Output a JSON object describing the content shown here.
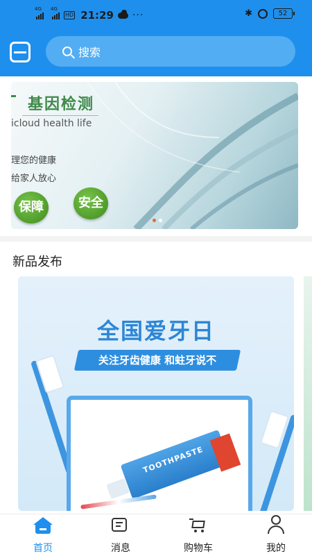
{
  "status_bar": {
    "network_1": "4G",
    "network_2": "4G",
    "hd": "HD",
    "time": "21:29",
    "more": "···",
    "bluetooth": "✱",
    "battery": "52"
  },
  "header": {
    "search_placeholder": "搜索",
    "scan_icon": "scan-icon",
    "search_icon": "search-icon",
    "background_color": "#1e8fec"
  },
  "banner": {
    "title": "基因检测",
    "subtitle": "icloud health life",
    "line1": "理您的健康",
    "line2": "给家人放心",
    "badge_1": "保障",
    "badge_2": "安全",
    "active_page": 1,
    "pages": 2
  },
  "new_products": {
    "section_title": "新品发布",
    "card": {
      "title": "全国爱牙日",
      "ribbon_text": "关注牙齿健康 和蛀牙说不",
      "product_text": "TOOTHPASTE"
    }
  },
  "bottom_nav": {
    "items": [
      {
        "label": "首页",
        "icon": "home-icon",
        "active": true
      },
      {
        "label": "消息",
        "icon": "message-icon",
        "active": false
      },
      {
        "label": "购物车",
        "icon": "cart-icon",
        "active": false
      },
      {
        "label": "我的",
        "icon": "user-icon",
        "active": false
      }
    ],
    "active_color": "#1e8fec"
  }
}
